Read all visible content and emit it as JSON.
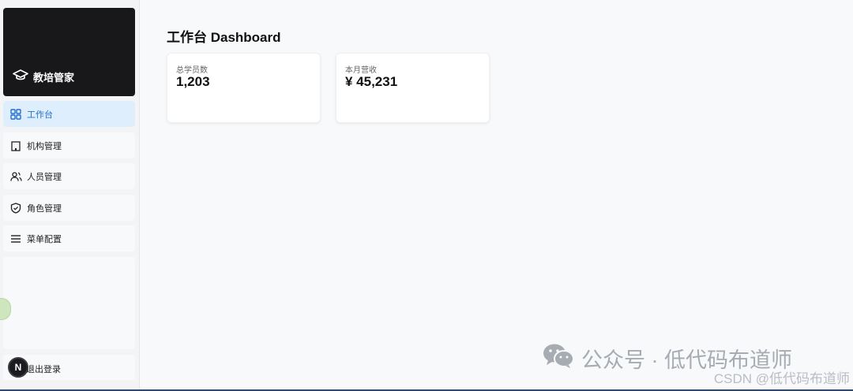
{
  "sidebar": {
    "brand": "教培管家",
    "items": [
      {
        "label": "工作台"
      },
      {
        "label": "机构管理"
      },
      {
        "label": "人员管理"
      },
      {
        "label": "角色管理"
      },
      {
        "label": "菜单配置"
      }
    ],
    "logout_label": "退出登录",
    "avatar_initial": "N"
  },
  "main": {
    "title": "工作台 Dashboard",
    "stats": [
      {
        "label": "总学员数",
        "value": "1,203"
      },
      {
        "label": "本月营收",
        "value": "¥ 45,231"
      }
    ]
  },
  "watermark": {
    "line1": "公众号 · 低代码布道师",
    "line2": "CSDN @低代码布道师"
  },
  "colors": {
    "accent": "#1f6fd1",
    "active_bg": "#dfeefc",
    "brand_bg": "#18181b"
  },
  "icons": [
    "graduation-cap-icon",
    "dashboard-grid-icon",
    "building-icon",
    "users-icon",
    "shield-icon",
    "menu-lines-icon",
    "wechat-icon"
  ]
}
